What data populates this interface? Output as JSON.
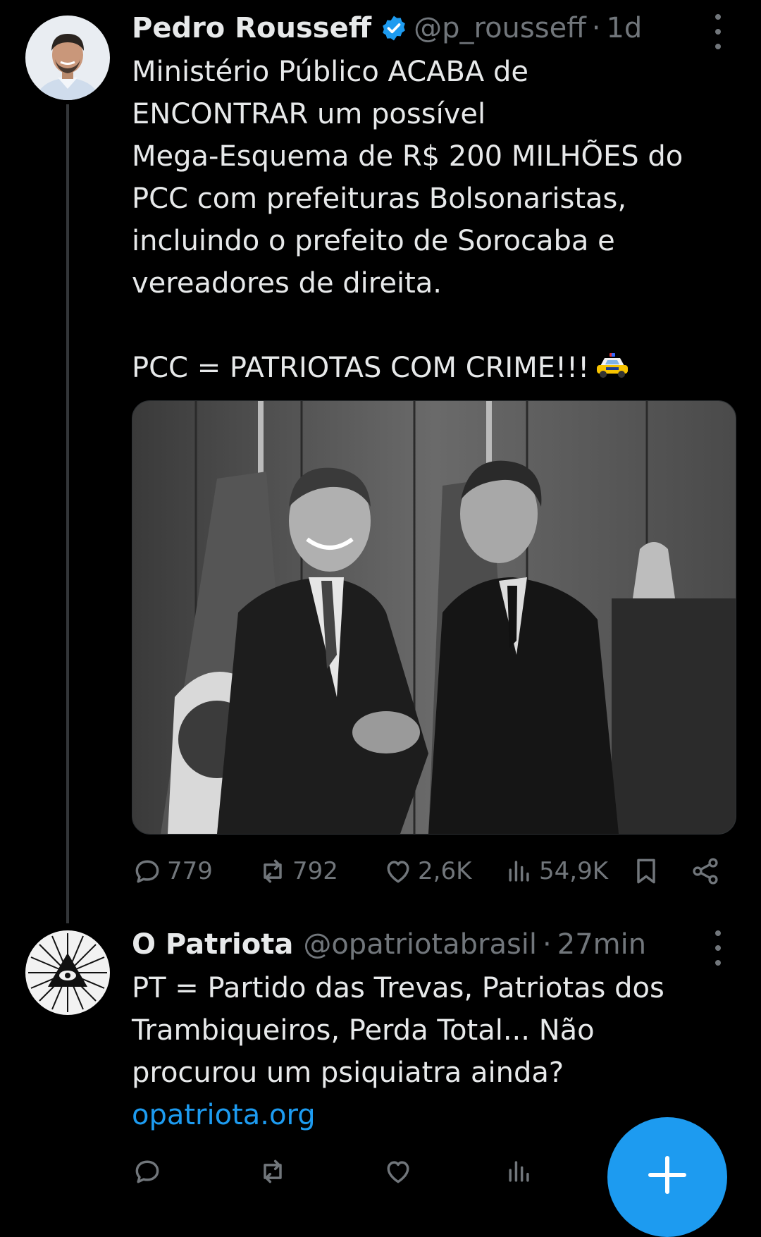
{
  "tweets": [
    {
      "name": "Pedro Rousseff",
      "handle": "@p_rousseff",
      "separator": "·",
      "time": "1d",
      "text": "Ministério Público ACABA de\nENCONTRAR um possível\nMega-Esquema de R$ 200 MILHÕES do\nPCC com prefeituras Bolsonaristas,\nincluindo o prefeito de Sorocaba e\nvereadores de direita.\n\nPCC = PATRIOTAS COM CRIME!!!",
      "emoji_icon": "police-car-icon",
      "replies": "779",
      "retweets": "792",
      "likes": "2,6K",
      "views": "54,9K"
    },
    {
      "name": "O Patriota",
      "handle": "@opatriotabrasil",
      "separator": "·",
      "time": "27min",
      "text": "PT = Partido das Trevas, Patriotas dos\nTrambiqueiros, Perda Total... Não\nprocurou um psiquiatra ainda?",
      "link": "opatriota.org"
    }
  ],
  "colors": {
    "background": "#000000",
    "text": "#e7e9ea",
    "muted": "#71767b",
    "accent": "#1d9bf0"
  }
}
